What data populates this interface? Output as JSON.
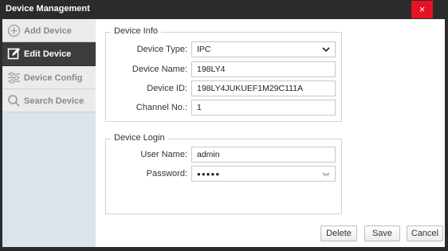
{
  "window": {
    "title": "Device Management",
    "close_glyph": "×"
  },
  "sidebar": {
    "items": [
      {
        "label": "Add Device",
        "icon": "plus-circle-icon",
        "active": false
      },
      {
        "label": "Edit Device",
        "icon": "edit-icon",
        "active": true
      },
      {
        "label": "Device Config",
        "icon": "sliders-icon",
        "active": false
      },
      {
        "label": "Search Device",
        "icon": "search-icon",
        "active": false
      }
    ]
  },
  "device_info": {
    "title": "Device Info",
    "device_type_label": "Device Type:",
    "device_type_value": "IPC",
    "device_name_label": "Device Name:",
    "device_name_value": "198LY4",
    "device_id_label": "Device ID:",
    "device_id_value": "198LY4JUKUEF1M29C111A",
    "channel_label": "Channel No.:",
    "channel_value": "1"
  },
  "device_login": {
    "title": "Device Login",
    "user_name_label": "User Name:",
    "user_name_value": "admin",
    "password_label": "Password:",
    "password_value": "●●●●●"
  },
  "footer": {
    "delete_label": "Delete",
    "save_label": "Save",
    "cancel_label": "Cancel"
  },
  "colors": {
    "titlebar": "#2b2b2b",
    "close_button": "#e81123",
    "sidebar_bg": "#dce4eb",
    "active_nav": "#3c3c3c"
  }
}
